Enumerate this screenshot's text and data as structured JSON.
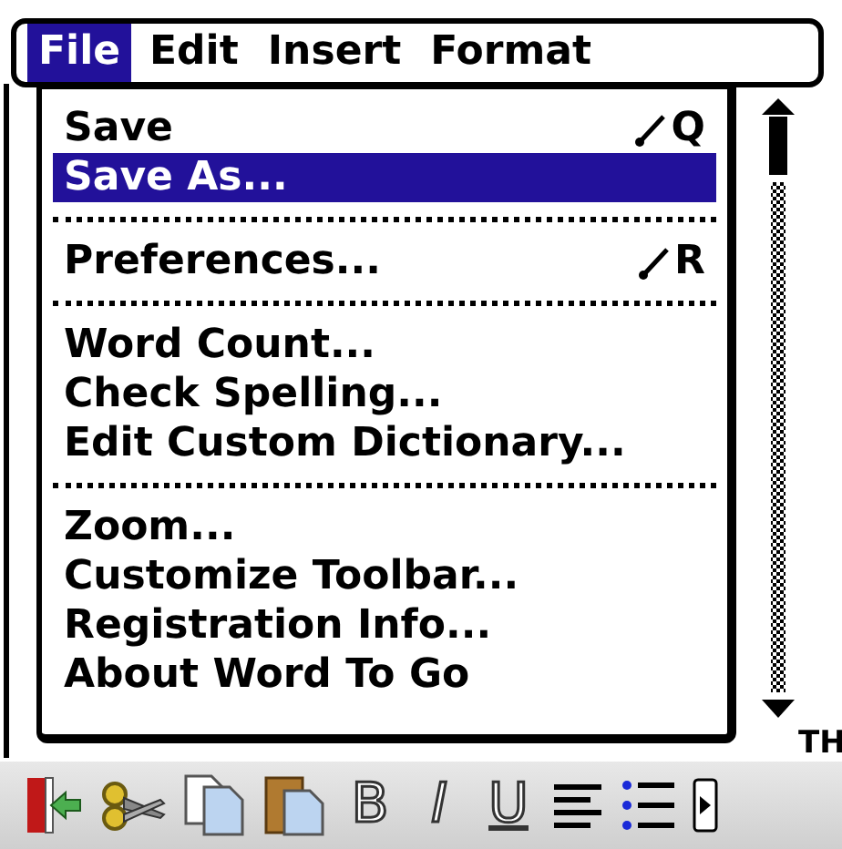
{
  "menu_bar": [
    {
      "label": "File",
      "selected": true
    },
    {
      "label": "Edit",
      "selected": false
    },
    {
      "label": "Insert",
      "selected": false
    },
    {
      "label": "Format",
      "selected": false
    }
  ],
  "menu": {
    "groups": [
      {
        "items": [
          {
            "label": "Save",
            "shortcut": "Q",
            "selected": false
          },
          {
            "label": "Save As...",
            "selected": true
          }
        ]
      },
      {
        "items": [
          {
            "label": "Preferences...",
            "shortcut": "R",
            "selected": false
          }
        ]
      },
      {
        "items": [
          {
            "label": "Word Count...",
            "selected": false
          },
          {
            "label": "Check Spelling...",
            "selected": false
          },
          {
            "label": "Edit Custom Dictionary...",
            "selected": false
          }
        ]
      },
      {
        "items": [
          {
            "label": "Zoom...",
            "selected": false
          },
          {
            "label": "Customize Toolbar...",
            "selected": false
          },
          {
            "label": "Registration Info...",
            "selected": false
          },
          {
            "label": "About Word To Go",
            "selected": false
          }
        ]
      }
    ]
  },
  "document_text": "TH",
  "toolbar": [
    {
      "kind": "exit"
    },
    {
      "kind": "cut"
    },
    {
      "kind": "copy"
    },
    {
      "kind": "paste"
    },
    {
      "kind": "glyph",
      "label": "B"
    },
    {
      "kind": "glyph",
      "label": "I",
      "italic": true
    },
    {
      "kind": "glyph",
      "label": "U",
      "underline": true
    },
    {
      "kind": "align"
    },
    {
      "kind": "list"
    },
    {
      "kind": "more"
    }
  ]
}
